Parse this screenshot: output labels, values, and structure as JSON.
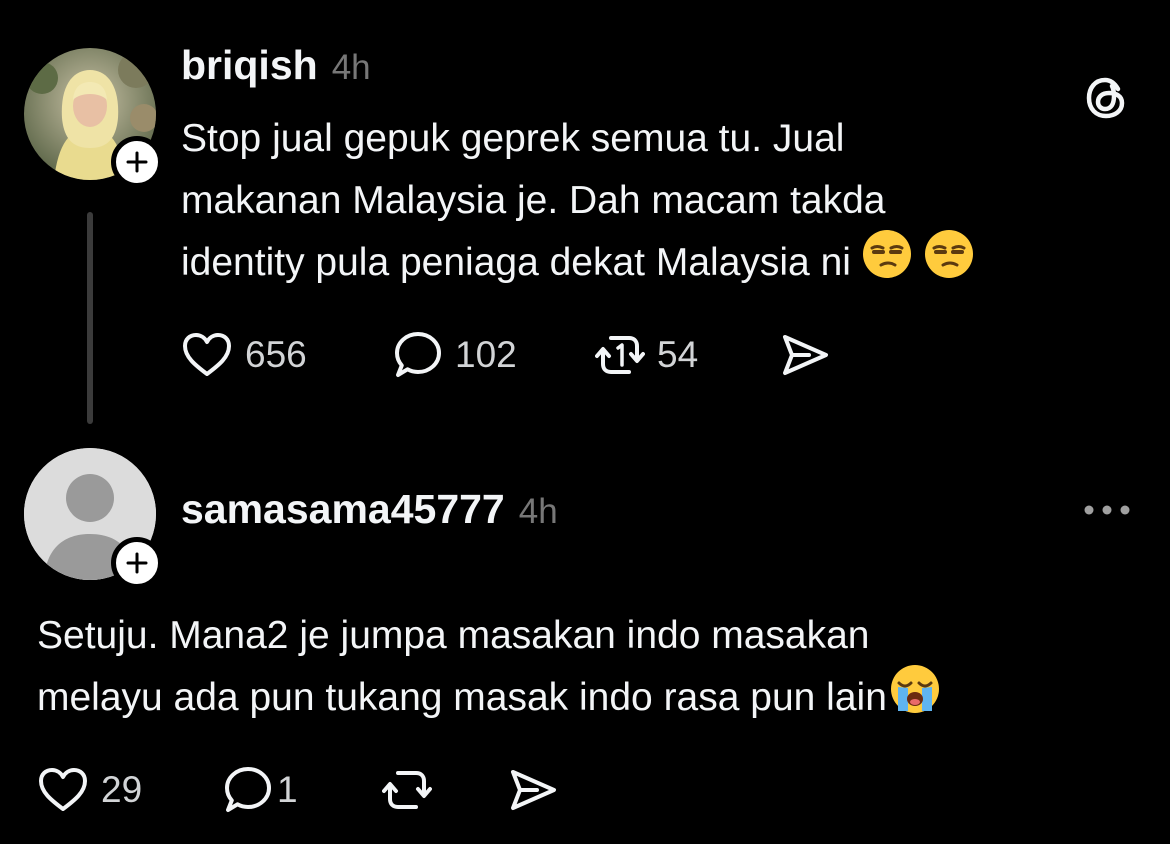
{
  "post": {
    "username": "briqish",
    "time": "4h",
    "text_lines": [
      "Stop jual gepuk geprek semua tu. Jual",
      "makanan Malaysia je. Dah macam takda",
      "identity pula peniaga dekat Malaysia ni"
    ],
    "emoji": [
      "unamused-face-emoji",
      "unamused-face-emoji"
    ],
    "likes": "656",
    "replies": "102",
    "reposts": "54"
  },
  "reply": {
    "username": "samasama45777",
    "time": "4h",
    "text_lines": [
      "Setuju. Mana2 je jumpa masakan indo masakan",
      "melayu ada pun tukang masak indo rasa pun lain"
    ],
    "emoji": [
      "loudly-crying-face-emoji"
    ],
    "likes": "29",
    "replies": "1",
    "reposts": ""
  },
  "icons": {
    "header": "threads-logo-icon",
    "more": "more-options-icon",
    "follow": "plus-icon",
    "actions": [
      "heart-icon",
      "comment-icon",
      "repost-icon",
      "share-icon"
    ]
  },
  "colors": {
    "background": "#000000",
    "primary_text": "#f3f5f7",
    "secondary_text": "#777777",
    "count_text": "#d2d4d6",
    "thread_line": "#3b3b3b"
  }
}
